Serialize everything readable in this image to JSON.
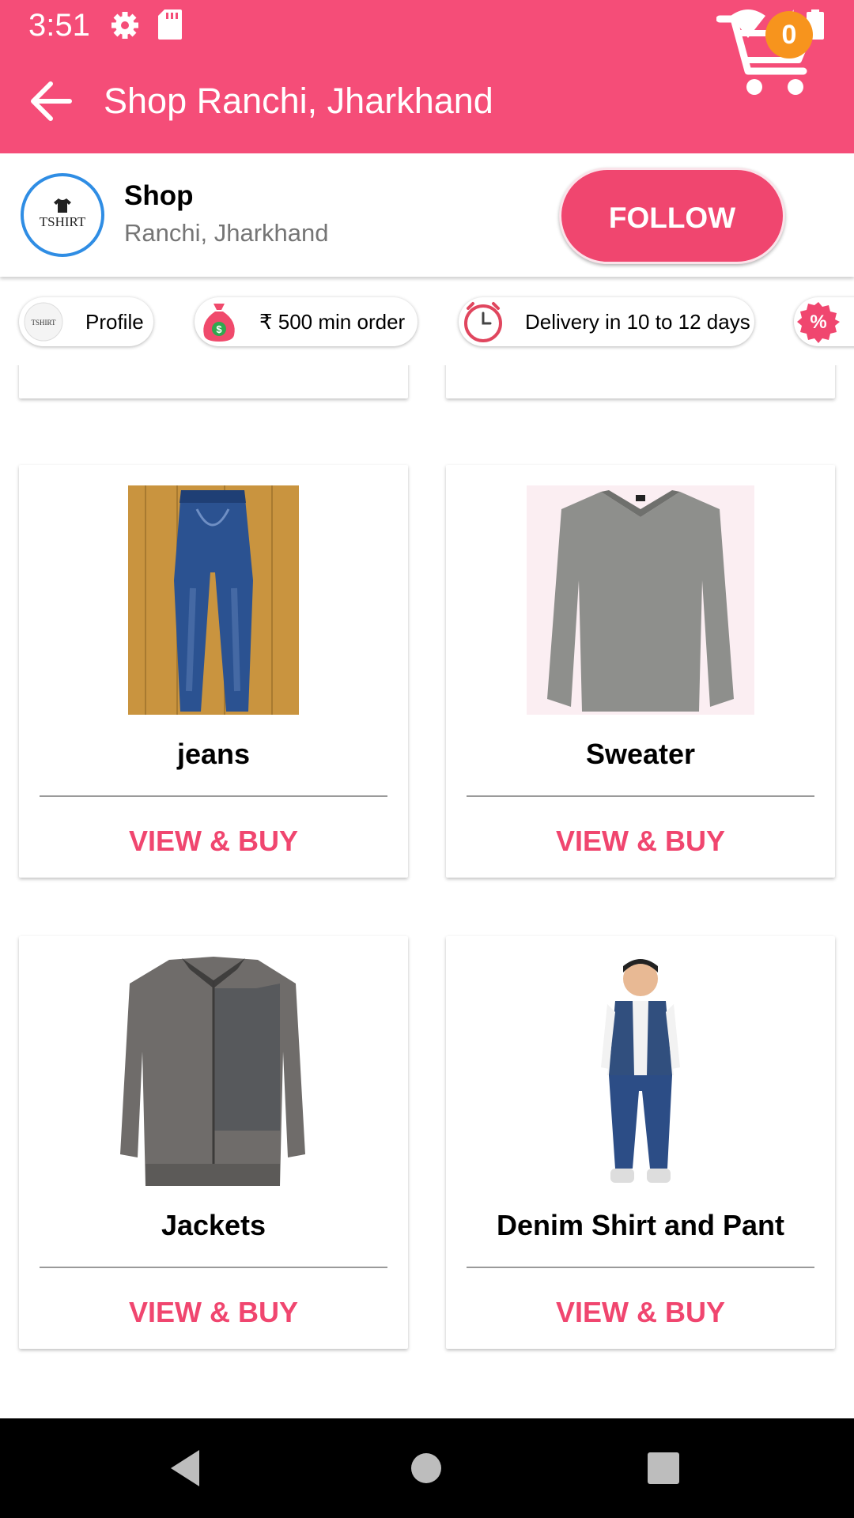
{
  "status_bar": {
    "time": "3:51",
    "icons": [
      "gear-icon",
      "sd-card-icon",
      "wifi-icon",
      "signal-icon",
      "battery-icon"
    ]
  },
  "app_bar": {
    "title": "Shop Ranchi, Jharkhand",
    "cart_count": "0"
  },
  "shop": {
    "logo_text": "TSHIRT",
    "name": "Shop",
    "location": "Ranchi, Jharkhand",
    "follow_label": "FOLLOW"
  },
  "chips": [
    {
      "icon": "shop-logo-icon",
      "label": "Profile"
    },
    {
      "icon": "money-bag-icon",
      "label": "₹ 500 min order"
    },
    {
      "icon": "clock-icon",
      "label": "Delivery in 10 to 12 days"
    },
    {
      "icon": "discount-icon",
      "label": ""
    }
  ],
  "products": [
    {
      "name": "jeans",
      "action": "VIEW & BUY",
      "image": "jeans-image"
    },
    {
      "name": "Sweater",
      "action": "VIEW & BUY",
      "image": "sweater-image"
    },
    {
      "name": "Jackets",
      "action": "VIEW & BUY",
      "image": "jacket-image"
    },
    {
      "name": "Denim Shirt and Pant",
      "action": "VIEW & BUY",
      "image": "kid-denim-image"
    }
  ],
  "colors": {
    "primary": "#f54d78",
    "accent": "#f0466f",
    "badge": "#f7941d",
    "logo_ring": "#2f8de4"
  }
}
